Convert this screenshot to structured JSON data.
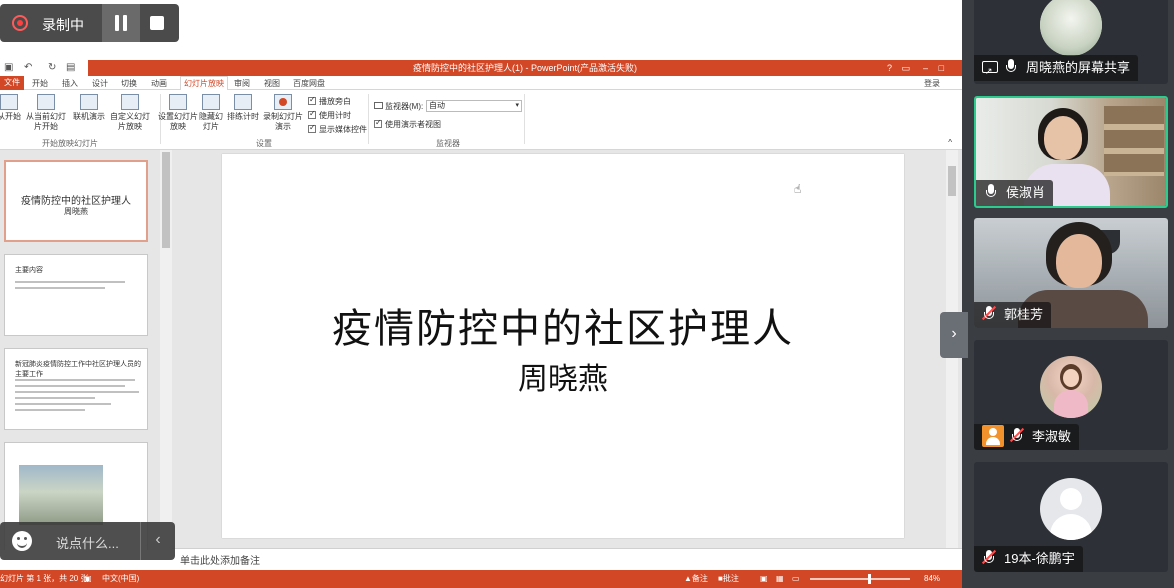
{
  "recording": {
    "label": "录制中"
  },
  "ppt": {
    "window_title": "疫情防控中的社区护理人(1) - PowerPoint(产品激活失败)",
    "login": "登录",
    "tabs": [
      "文件",
      "开始",
      "插入",
      "设计",
      "切换",
      "动画",
      "幻灯片放映",
      "审阅",
      "视图",
      "百度网盘"
    ],
    "active_tab": "幻灯片放映",
    "ribbon": {
      "buttons": [
        {
          "label": "从开始",
          "name": "from-start-button"
        },
        {
          "label": "从当前幻灯片开始",
          "name": "from-current-button"
        },
        {
          "label": "联机演示",
          "name": "online-present-button"
        },
        {
          "label": "自定义幻灯片放映",
          "name": "custom-show-button"
        },
        {
          "label": "设置幻灯片放映",
          "name": "setup-show-button"
        },
        {
          "label": "隐藏幻灯片",
          "name": "hide-slide-button"
        },
        {
          "label": "排练计时",
          "name": "rehearse-button"
        },
        {
          "label": "录制幻灯片演示",
          "name": "record-show-button"
        }
      ],
      "groups": {
        "start": "开始放映幻灯片",
        "setup": "设置",
        "monitor": "监视器"
      },
      "checkboxes": {
        "narration": "播放旁白",
        "timing": "使用计时",
        "media": "显示媒体控件",
        "presenter": "使用演示者视图"
      },
      "monitor_label": "监视器(M):",
      "monitor_value": "自动"
    },
    "thumbnails": {
      "s1_title": "疫情防控中的社区护理人",
      "s1_sub": "周晓燕",
      "s2_title": "主要内容",
      "s3_title": "新冠肺炎疫情防控工作中社区护理人员的主要工作"
    },
    "slide": {
      "title": "疫情防控中的社区护理人",
      "subtitle": "周晓燕"
    },
    "notes_placeholder": "单击此处添加备注",
    "status": {
      "slide_info": "幻灯片 第 1 张，共 20 张",
      "language": "中文(中国)",
      "notes": "备注",
      "comments": "批注",
      "zoom": "84%"
    }
  },
  "chat": {
    "placeholder": "说点什么..."
  },
  "participants": [
    {
      "name": "周晓燕的屏幕共享",
      "type": "share"
    },
    {
      "name": "侯淑肖",
      "type": "video",
      "muted": false
    },
    {
      "name": "郭桂芳",
      "type": "video",
      "muted": true
    },
    {
      "name": "李淑敏",
      "type": "avatar",
      "muted": true
    },
    {
      "name": "19本-徐鹏宇",
      "type": "avatar",
      "muted": true
    }
  ],
  "colors": {
    "ppt_accent": "#d24726",
    "active_speaker": "#2bcc8e",
    "panel_bg": "#3a3d42",
    "record_red": "#ff4040"
  }
}
